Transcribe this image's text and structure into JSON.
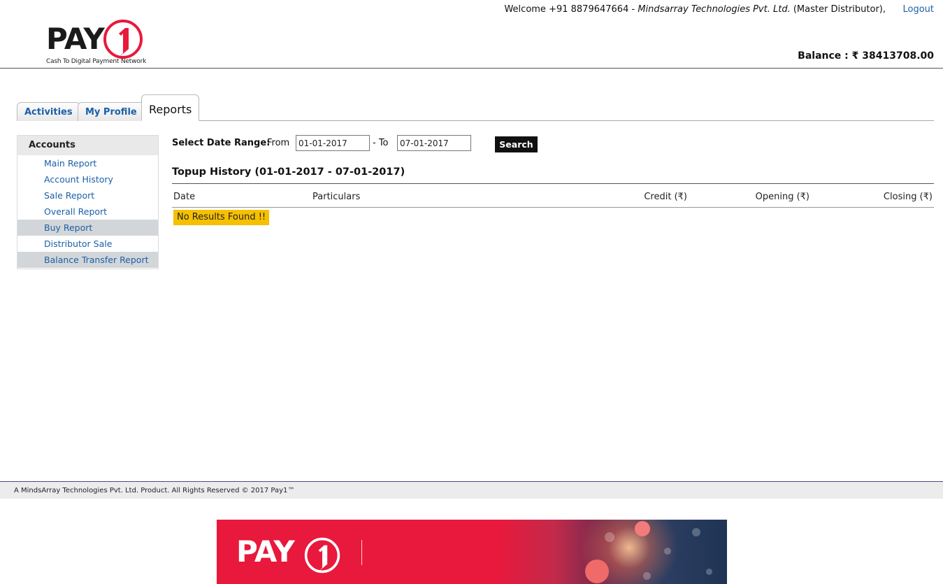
{
  "header": {
    "logo": {
      "brand": "PAY",
      "brand_one": "1",
      "tagline": "Cash To Digital Payment Network"
    },
    "welcome": {
      "prefix": "Welcome +91 8879647664 - ",
      "company": "Mindsarray Technologies Pvt. Ltd.",
      "role": " (Master Distributor),"
    },
    "logout_label": "Logout",
    "balance_label": "Balance : ₹ 38413708.00"
  },
  "tabs": [
    {
      "label": "Activities",
      "active": false
    },
    {
      "label": "My Profile",
      "active": false
    },
    {
      "label": "Reports",
      "active": true
    }
  ],
  "sidebar": {
    "heading": "Accounts",
    "items": [
      {
        "label": "Main Report",
        "highlighted": false
      },
      {
        "label": "Account History",
        "highlighted": false
      },
      {
        "label": "Sale Report",
        "highlighted": false
      },
      {
        "label": "Overall Report",
        "highlighted": false
      },
      {
        "label": "Buy Report",
        "highlighted": true
      },
      {
        "label": "Distributor Sale",
        "highlighted": false
      },
      {
        "label": "Balance Transfer Report",
        "highlighted": true
      }
    ]
  },
  "date_range": {
    "label": "Select Date Range:",
    "from_label": "From",
    "from_value": "01-01-2017",
    "to_label": "- To",
    "to_value": "07-01-2017",
    "search_label": "Search"
  },
  "history": {
    "title": "Topup History (01-01-2017 - 07-01-2017)",
    "columns": {
      "date": "Date",
      "particulars": "Particulars",
      "credit": "Credit (₹)",
      "opening": "Opening (₹)",
      "closing": "Closing (₹)"
    },
    "no_results": "No Results Found !!"
  },
  "footer": {
    "text": "A MindsArray Technologies Pvt. Ltd. Product. All Rights Reserved © 2017 Pay1™"
  },
  "banner": {
    "brand": "PAY",
    "brand_one": "1"
  },
  "colors": {
    "link": "#1b5fa8",
    "brand_red": "#e8193c",
    "no_results_bg": "#f5c000",
    "highlight_row": "#d3d6d9"
  }
}
